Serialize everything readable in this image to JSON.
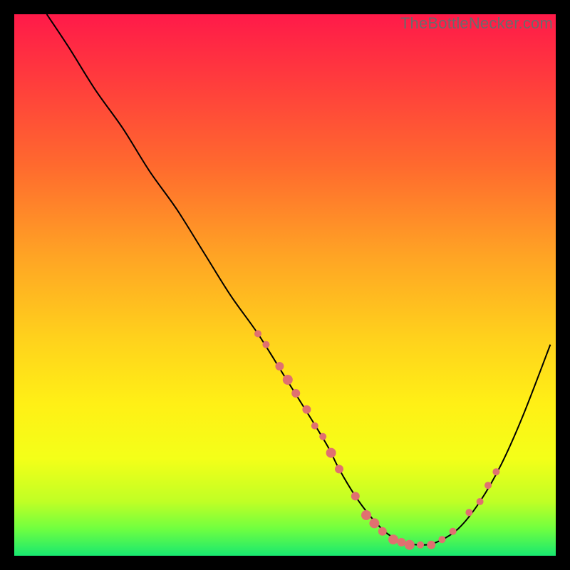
{
  "watermark": "TheBottleNecker.com",
  "colors": {
    "bg": "#000000",
    "curve": "#000000",
    "marker_fill": "#e07070",
    "marker_stroke": "#d85a5a",
    "gradient_stops": [
      {
        "offset": 0.0,
        "color": "#ff1a49"
      },
      {
        "offset": 0.12,
        "color": "#ff3b3d"
      },
      {
        "offset": 0.28,
        "color": "#ff6a2e"
      },
      {
        "offset": 0.45,
        "color": "#ffa524"
      },
      {
        "offset": 0.6,
        "color": "#ffd21c"
      },
      {
        "offset": 0.72,
        "color": "#fff016"
      },
      {
        "offset": 0.82,
        "color": "#f4ff18"
      },
      {
        "offset": 0.9,
        "color": "#c0ff25"
      },
      {
        "offset": 0.95,
        "color": "#70ff40"
      },
      {
        "offset": 1.0,
        "color": "#18e870"
      }
    ]
  },
  "chart_data": {
    "type": "line",
    "title": "",
    "xlabel": "",
    "ylabel": "",
    "xlim": [
      0,
      100
    ],
    "ylim": [
      0,
      100
    ],
    "series": [
      {
        "name": "bottleneck-curve",
        "x": [
          6,
          10,
          15,
          20,
          25,
          30,
          35,
          40,
          45,
          50,
          55,
          58,
          60,
          63,
          66,
          69,
          72,
          75,
          78,
          82,
          86,
          90,
          94,
          99
        ],
        "y": [
          100,
          94,
          86,
          79,
          71,
          64,
          56,
          48,
          41,
          33,
          25,
          20,
          16,
          11,
          7,
          4,
          2.5,
          2,
          2.5,
          5,
          10,
          17,
          26,
          39
        ]
      }
    ],
    "markers": [
      {
        "x": 45,
        "y": 41,
        "r": 5
      },
      {
        "x": 46.5,
        "y": 39,
        "r": 5
      },
      {
        "x": 49,
        "y": 35,
        "r": 6
      },
      {
        "x": 50.5,
        "y": 32.5,
        "r": 7
      },
      {
        "x": 52,
        "y": 30,
        "r": 6
      },
      {
        "x": 54,
        "y": 27,
        "r": 6
      },
      {
        "x": 55.5,
        "y": 24,
        "r": 5
      },
      {
        "x": 57,
        "y": 22,
        "r": 5
      },
      {
        "x": 58.5,
        "y": 19,
        "r": 7
      },
      {
        "x": 60,
        "y": 16,
        "r": 6
      },
      {
        "x": 63,
        "y": 11,
        "r": 6
      },
      {
        "x": 65,
        "y": 7.5,
        "r": 7
      },
      {
        "x": 66.5,
        "y": 6,
        "r": 7
      },
      {
        "x": 68,
        "y": 4.5,
        "r": 6
      },
      {
        "x": 70,
        "y": 3,
        "r": 7
      },
      {
        "x": 71.5,
        "y": 2.5,
        "r": 6
      },
      {
        "x": 73,
        "y": 2,
        "r": 7
      },
      {
        "x": 75,
        "y": 2,
        "r": 5
      },
      {
        "x": 77,
        "y": 2,
        "r": 6
      },
      {
        "x": 79,
        "y": 3,
        "r": 5
      },
      {
        "x": 81,
        "y": 4.5,
        "r": 5
      },
      {
        "x": 84,
        "y": 8,
        "r": 5
      },
      {
        "x": 86,
        "y": 10,
        "r": 5
      },
      {
        "x": 87.5,
        "y": 13,
        "r": 5
      },
      {
        "x": 89,
        "y": 15.5,
        "r": 5
      }
    ]
  }
}
